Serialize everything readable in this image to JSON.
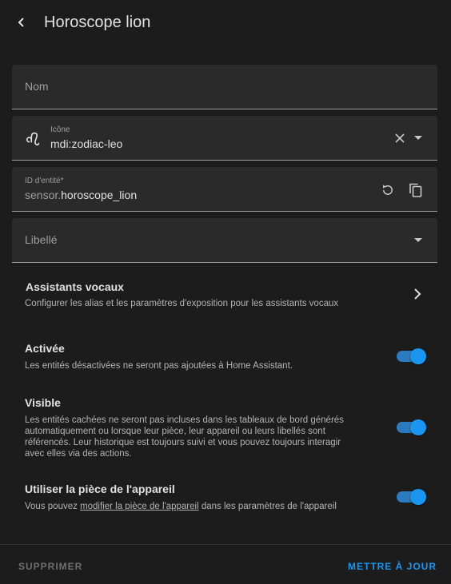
{
  "header": {
    "title": "Horoscope lion"
  },
  "fields": {
    "nom": {
      "placeholder": "Nom"
    },
    "icone": {
      "label": "Icône",
      "value": "mdi:zodiac-leo"
    },
    "entity_id": {
      "label": "ID d'entité*",
      "prefix": "sensor.",
      "value": "horoscope_lion"
    },
    "libelle": {
      "placeholder": "Libellé"
    }
  },
  "voice_assistants": {
    "title": "Assistants vocaux",
    "description": "Configurer les alias et les paramètres d'exposition pour les assistants vocaux"
  },
  "enabled": {
    "title": "Activée",
    "description": "Les entités désactivées ne seront pas ajoutées à Home Assistant.",
    "on": true
  },
  "visible": {
    "title": "Visible",
    "description_lines": [
      "Les entités cachées ne seront pas incluses dans les tableaux de bord générés",
      "automatiquement ou lorsque leur pièce, leur appareil ou leurs libellés sont",
      "référencés. Leur historique est toujours suivi et vous pouvez toujours interagir",
      "avec elles via des actions."
    ],
    "on": true
  },
  "area": {
    "title": "Utiliser la pièce de l'appareil",
    "description_before": "Vous pouvez ",
    "link_text": "modifier la pièce de l'appareil",
    "description_after": " dans les paramètres de l'appareil",
    "on": true
  },
  "footer": {
    "delete_label": "SUPPRIMER",
    "update_label": "METTRE À JOUR"
  },
  "colors": {
    "background": "#1c1c1c",
    "field_bg": "#2a2a2a",
    "accent": "#1a96f0",
    "muted": "#6f6f6f"
  },
  "icons": {
    "back": "chevron-left-icon",
    "leo": "zodiac-leo-icon",
    "clear": "close-icon",
    "dropdown": "menu-down-icon",
    "regenerate": "restore-icon",
    "copy": "content-copy-icon",
    "next": "chevron-right-icon"
  }
}
